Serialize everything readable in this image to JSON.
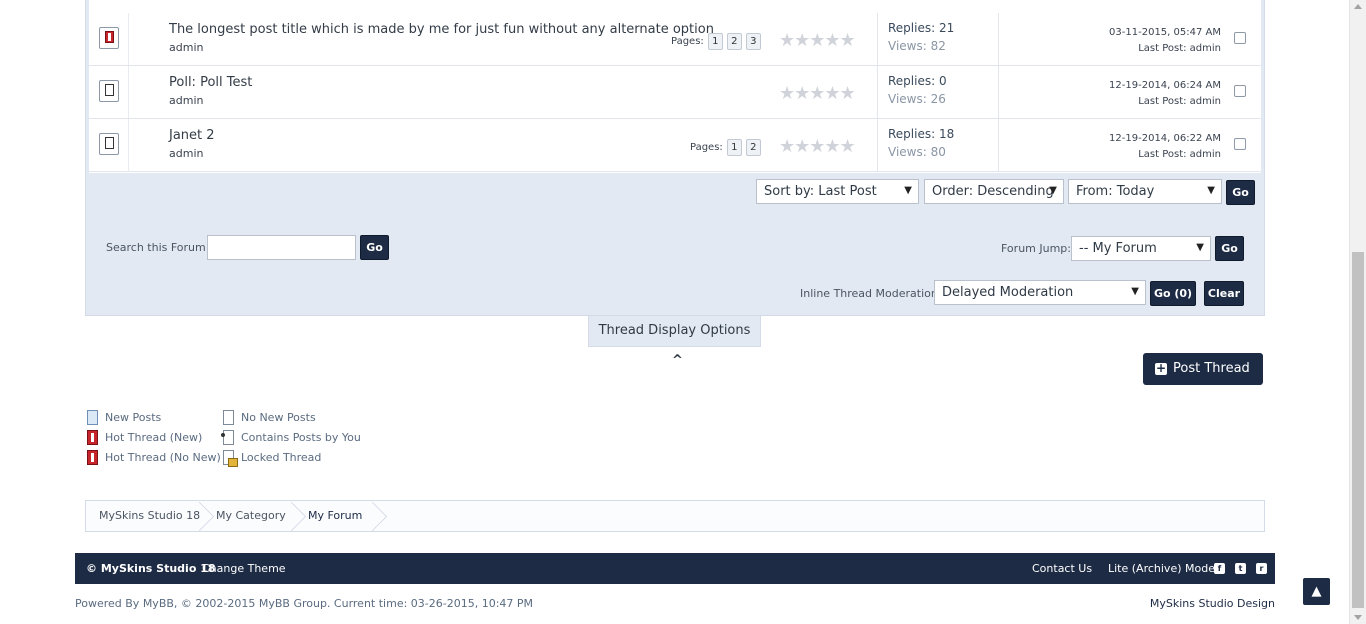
{
  "threads": [
    {
      "title": "The longest post title which is made by me for just fun without any alternate option",
      "author": "admin",
      "pages_label": "Pages:",
      "pages": [
        "1",
        "2",
        "3"
      ],
      "stars": "★★★★★",
      "replies": "Replies: 21",
      "views": "Views: 82",
      "date": "03-11-2015, 05:47 AM",
      "lastpost": "Last Post: admin",
      "hot": true
    },
    {
      "title": "Poll: Poll Test",
      "author": "admin",
      "pages_label": "",
      "pages": [],
      "stars": "★★★★★",
      "replies": "Replies: 0",
      "views": "Views: 26",
      "date": "12-19-2014, 06:24 AM",
      "lastpost": "Last Post: admin",
      "hot": false
    },
    {
      "title": "Janet 2",
      "author": "admin",
      "pages_label": "Pages:",
      "pages": [
        "1",
        "2"
      ],
      "stars": "★★★★★",
      "replies": "Replies: 18",
      "views": "Views: 80",
      "date": "12-19-2014, 06:22 AM",
      "lastpost": "Last Post: admin",
      "hot": false
    }
  ],
  "sort": {
    "sort_by": "Sort by: Last Post",
    "order": "Order: Descending",
    "from": "From: Today",
    "go": "Go"
  },
  "search": {
    "label": "Search this Forum:",
    "go": "Go"
  },
  "jump": {
    "label": "Forum Jump:",
    "value": "-- My Forum",
    "go": "Go"
  },
  "moderation": {
    "label": "Inline Thread Moderation:",
    "value": "Delayed Moderation",
    "go": "Go (0)",
    "clear": "Clear"
  },
  "display_options": "Thread Display Options",
  "post_thread": "Post Thread",
  "legend": {
    "new_posts": "New Posts",
    "no_new_posts": "No New Posts",
    "hot_new": "Hot Thread (New)",
    "contains_yours": "Contains Posts by You",
    "hot_no_new": "Hot Thread (No New)",
    "locked": "Locked Thread"
  },
  "breadcrumb": [
    "MySkins Studio 18",
    "My Category",
    "My Forum"
  ],
  "footer": {
    "copyright": "© MySkins Studio 18",
    "change_theme": "Change Theme",
    "contact": "Contact Us",
    "lite": "Lite (Archive) Mode",
    "powered": "Powered By MyBB, © 2002-2015 MyBB Group. Current time: 03-26-2015, 10:47 PM",
    "designer": "MySkins Studio Design"
  },
  "icons": {
    "facebook": "f",
    "twitter": "t",
    "rss": "r",
    "up": "▲",
    "caret": "▼",
    "chevron_up": "⌃"
  },
  "colors": {
    "accent": "#1d2b45",
    "panel": "#e3e9f2"
  }
}
